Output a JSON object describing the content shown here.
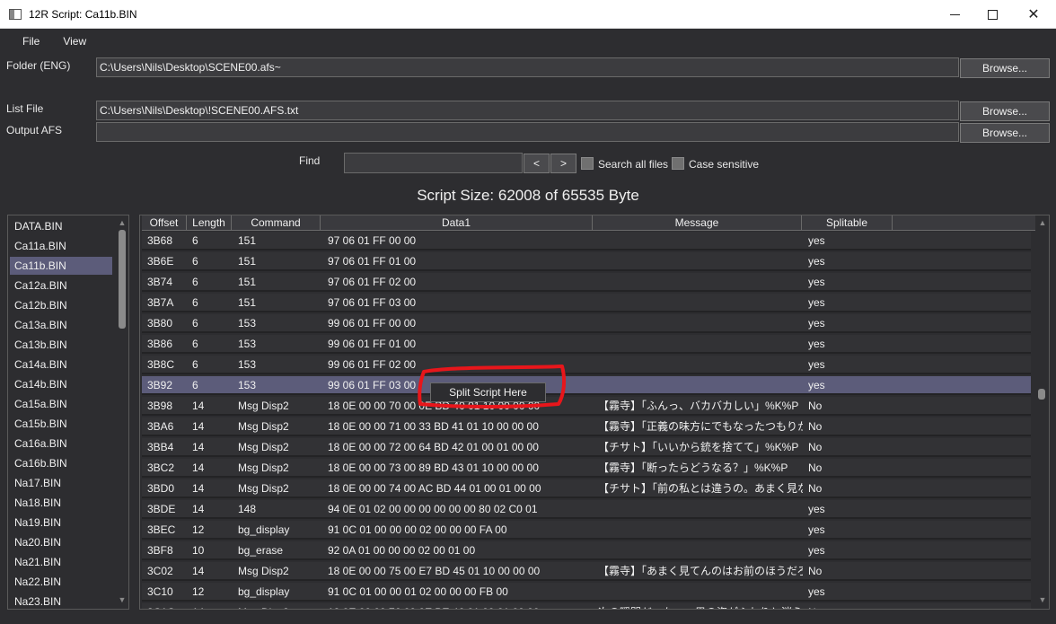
{
  "window": {
    "title": "12R Script: Ca11b.BIN",
    "minimize_icon": "minimize-icon",
    "maximize_icon": "maximize-icon",
    "close_glyph": "✕"
  },
  "menu": [
    "File",
    "View"
  ],
  "folder": {
    "label": "Folder (ENG)",
    "value": "C:\\Users\\Nils\\Desktop\\SCENE00.afs~",
    "browse": "Browse..."
  },
  "list_file": {
    "label": "List File",
    "value": "C:\\Users\\Nils\\Desktop\\!SCENE00.AFS.txt",
    "browse": "Browse..."
  },
  "output_afs": {
    "label": "Output AFS",
    "value": "",
    "browse": "Browse..."
  },
  "find": {
    "label": "Find",
    "value": "",
    "prev": "<",
    "next": ">",
    "search_all_files": "Search all files",
    "case_sensitive": "Case sensitive"
  },
  "script_size": "Script Size: 62008 of 65535 Byte",
  "files": [
    "DATA.BIN",
    "Ca11a.BIN",
    "Ca11b.BIN",
    "Ca12a.BIN",
    "Ca12b.BIN",
    "Ca13a.BIN",
    "Ca13b.BIN",
    "Ca14a.BIN",
    "Ca14b.BIN",
    "Ca15a.BIN",
    "Ca15b.BIN",
    "Ca16a.BIN",
    "Ca16b.BIN",
    "Na17.BIN",
    "Na18.BIN",
    "Na19.BIN",
    "Na20.BIN",
    "Na21.BIN",
    "Na22.BIN",
    "Na23.BIN"
  ],
  "selected_file": "Ca11b.BIN",
  "columns": [
    "Offset",
    "Length",
    "Command",
    "Data1",
    "Message",
    "Splitable"
  ],
  "rows": [
    {
      "offset": "3B68",
      "length": "6",
      "command": "151",
      "data1": "97 06 01 FF 00 00",
      "message": "",
      "splitable": "yes"
    },
    {
      "offset": "3B6E",
      "length": "6",
      "command": "151",
      "data1": "97 06 01 FF 01 00",
      "message": "",
      "splitable": "yes"
    },
    {
      "offset": "3B74",
      "length": "6",
      "command": "151",
      "data1": "97 06 01 FF 02 00",
      "message": "",
      "splitable": "yes"
    },
    {
      "offset": "3B7A",
      "length": "6",
      "command": "151",
      "data1": "97 06 01 FF 03 00",
      "message": "",
      "splitable": "yes"
    },
    {
      "offset": "3B80",
      "length": "6",
      "command": "153",
      "data1": "99 06 01 FF 00 00",
      "message": "",
      "splitable": "yes"
    },
    {
      "offset": "3B86",
      "length": "6",
      "command": "153",
      "data1": "99 06 01 FF 01 00",
      "message": "",
      "splitable": "yes"
    },
    {
      "offset": "3B8C",
      "length": "6",
      "command": "153",
      "data1": "99 06 01 FF 02 00",
      "message": "",
      "splitable": "yes"
    },
    {
      "offset": "3B92",
      "length": "6",
      "command": "153",
      "data1": "99 06 01 FF 03 00",
      "message": "",
      "splitable": "yes"
    },
    {
      "offset": "3B98",
      "length": "14",
      "command": "Msg Disp2",
      "data1": "18 0E 00 00 70 00 0E BD 40 01 10 00 00 00",
      "message": "【霧寺】「ふんっ、バカバカしい」%K%P",
      "splitable": "No"
    },
    {
      "offset": "3BA6",
      "length": "14",
      "command": "Msg Disp2",
      "data1": "18 0E 00 00 71 00 33 BD 41 01 10 00 00 00",
      "message": "【霧寺】「正義の味方にでもなったつもりか？」%K",
      "splitable": "No"
    },
    {
      "offset": "3BB4",
      "length": "14",
      "command": "Msg Disp2",
      "data1": "18 0E 00 00 72 00 64 BD 42 01 00 01 00 00",
      "message": "【チサト】「いいから銃を捨てて」%K%P",
      "splitable": "No"
    },
    {
      "offset": "3BC2",
      "length": "14",
      "command": "Msg Disp2",
      "data1": "18 0E 00 00 73 00 89 BD 43 01 10 00 00 00",
      "message": "【霧寺】「断ったらどうなる？」%K%P",
      "splitable": "No"
    },
    {
      "offset": "3BD0",
      "length": "14",
      "command": "Msg Disp2",
      "data1": "18 0E 00 00 74 00 AC BD 44 01 00 01 00 00",
      "message": "【チサト】「前の私とは違うの。あまく見ないでくれ",
      "splitable": "No"
    },
    {
      "offset": "3BDE",
      "length": "14",
      "command": "148",
      "data1": "94 0E 01 02 00 00 00 00 00 00 80 02 C0 01",
      "message": "",
      "splitable": "yes"
    },
    {
      "offset": "3BEC",
      "length": "12",
      "command": "bg_display",
      "data1": "91 0C 01 00 00 00 02 00 00 00 FA 00",
      "message": "",
      "splitable": "yes"
    },
    {
      "offset": "3BF8",
      "length": "10",
      "command": "bg_erase",
      "data1": "92 0A 01 00 00 00 02 00 01 00",
      "message": "",
      "splitable": "yes"
    },
    {
      "offset": "3C02",
      "length": "14",
      "command": "Msg Disp2",
      "data1": "18 0E 00 00 75 00 E7 BD 45 01 10 00 00 00",
      "message": "【霧寺】「あまく見てんのはお前のほうだろ、チサト",
      "splitable": "No"
    },
    {
      "offset": "3C10",
      "length": "12",
      "command": "bg_display",
      "data1": "91 0C 01 00 00 01 02 00 00 00 FB 00",
      "message": "",
      "splitable": "yes"
    },
    {
      "offset": "3C1C",
      "length": "14",
      "command": "Msg Disp2",
      "data1": "18 0E 00 00 76 00 0E BE 46 01 00 01 00 00",
      "message": "次の瞬間だった——男の姿がふわりと消えた",
      "splitable": "No"
    }
  ],
  "selected_row": "3B92",
  "context_menu": {
    "item": "Split Script Here"
  },
  "annotation_color": "#e8161b"
}
